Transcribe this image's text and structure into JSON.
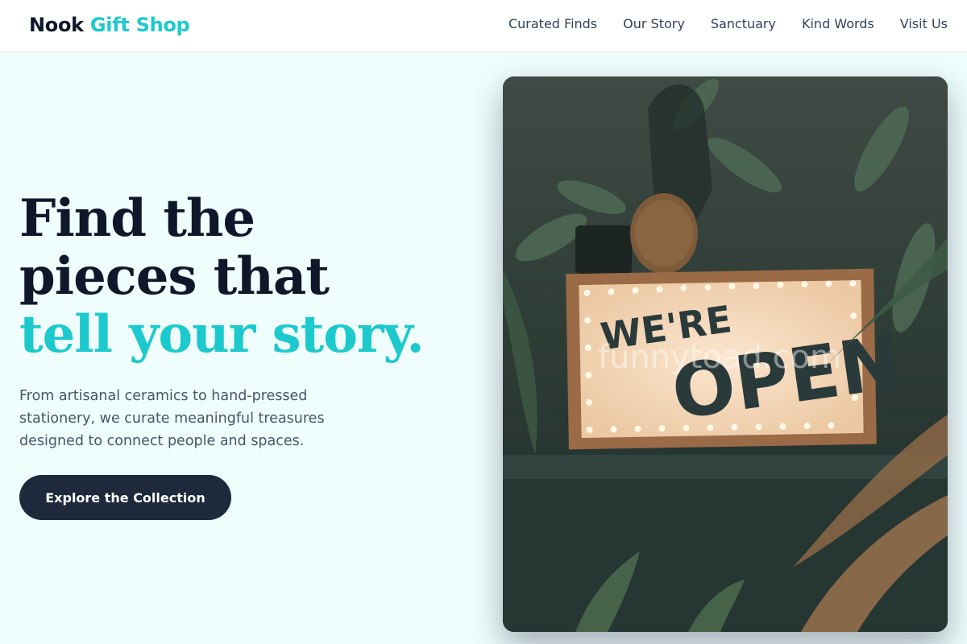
{
  "brand": {
    "name_part1": "Nook",
    "name_part2": "Gift Shop"
  },
  "nav": {
    "items": [
      "Curated Finds",
      "Our Story",
      "Sanctuary",
      "Kind Words",
      "Visit Us"
    ]
  },
  "hero": {
    "headline_part1": "Find the pieces that ",
    "headline_accent": "tell your story.",
    "subtext": "From artisanal ceramics to hand-pressed stationery, we curate meaningful treasures designed to connect people and spaces.",
    "cta_label": "Explore the Collection"
  },
  "photo": {
    "sign_line1": "WE'RE",
    "sign_line2": "OPEN",
    "watermark": "funnytoad.com"
  },
  "colors": {
    "accent": "#1cc9cd",
    "dark": "#0f172a",
    "button": "#1e293b",
    "background": "#effdfd"
  }
}
